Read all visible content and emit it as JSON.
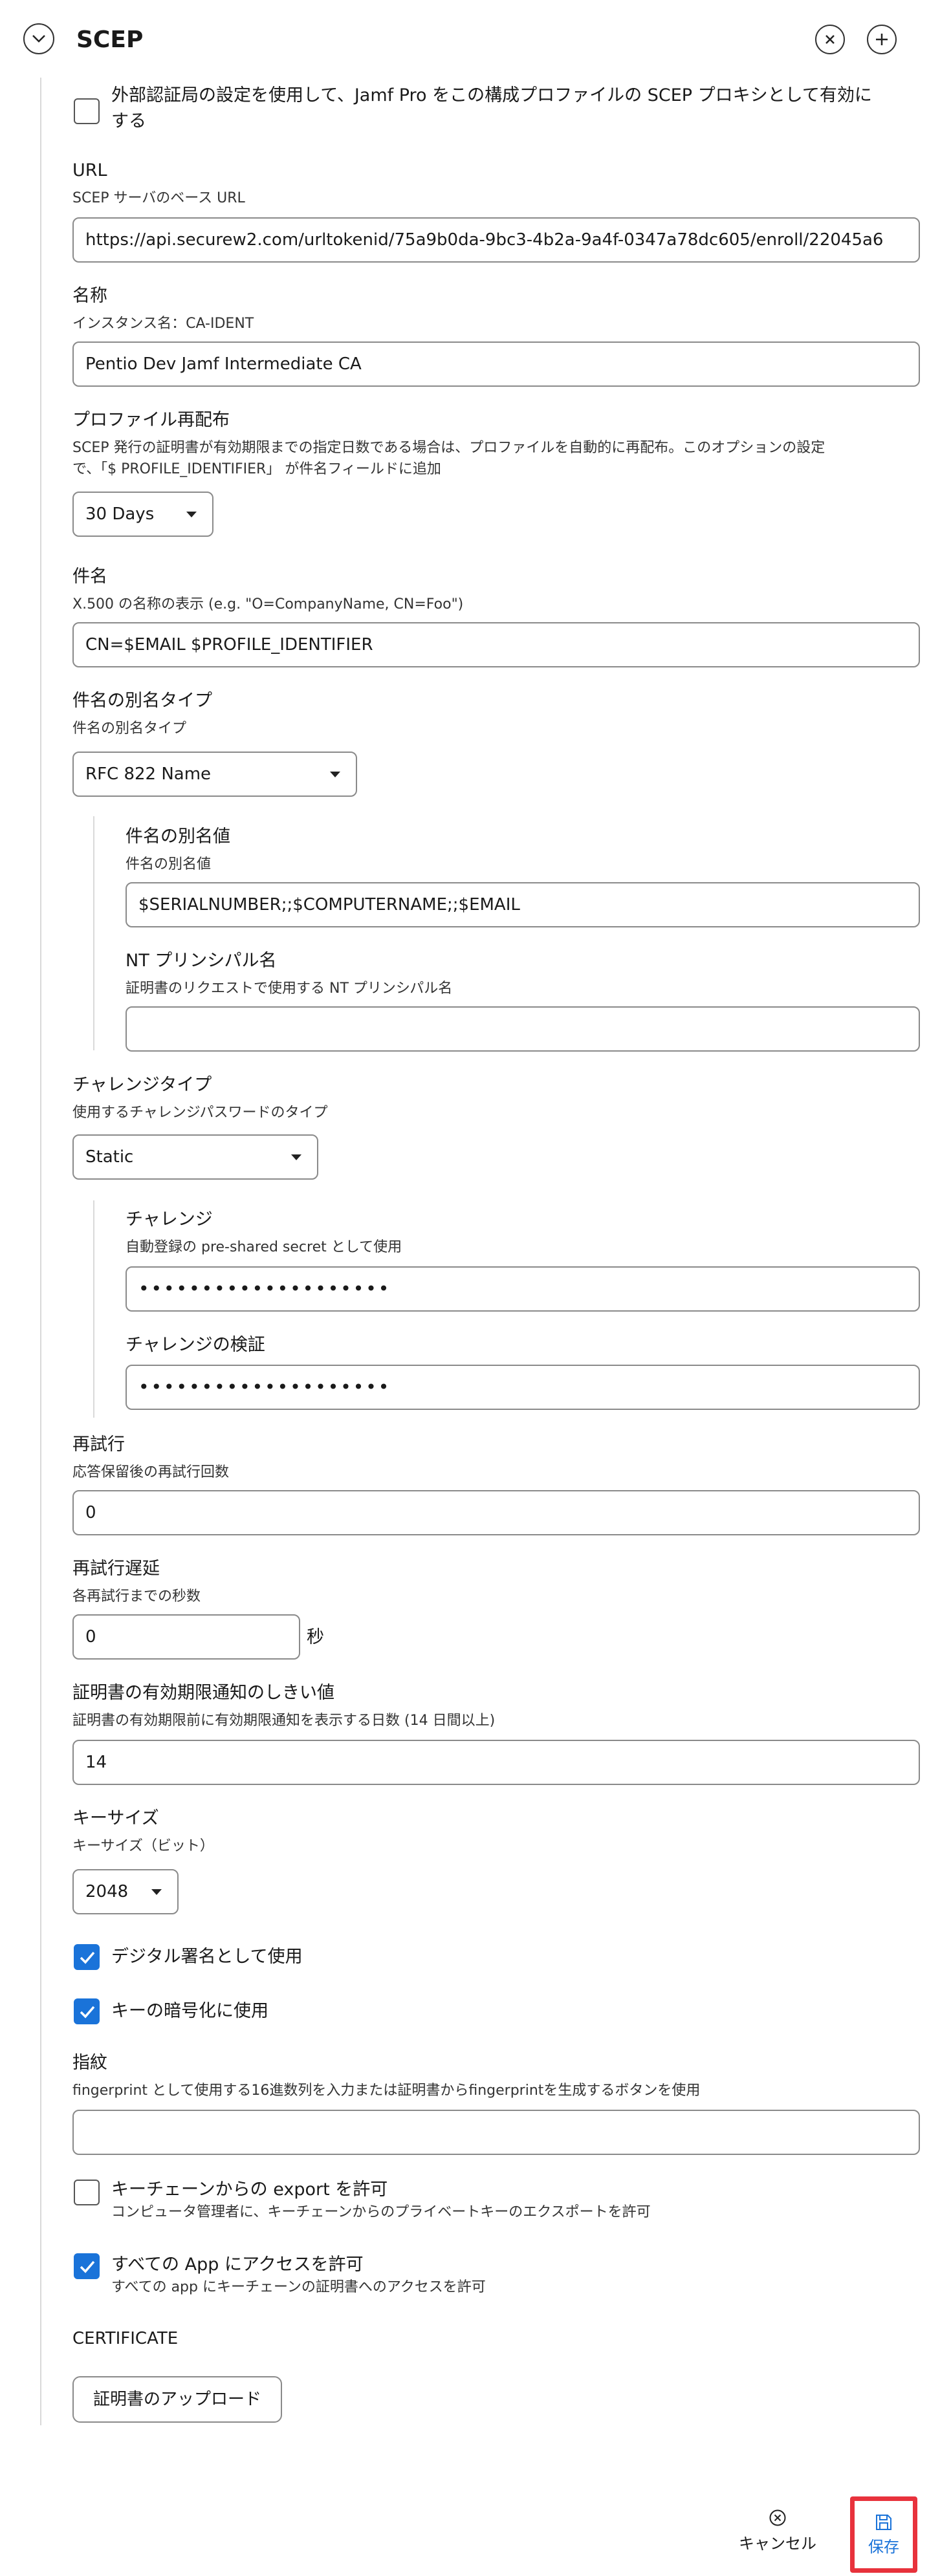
{
  "header": {
    "title": "SCEP"
  },
  "scep": {
    "proxy_checkbox_label_1": "外部認証局の設定を使用して、Jamf Pro をこの構成プロファイルの SCEP プロキシとして有効に",
    "proxy_checkbox_label_2": "する",
    "proxy_checked": false,
    "url_label": "URL",
    "url_desc": "SCEP サーバのベース URL",
    "url_value": "https://api.securew2.com/urltokenid/75a9b0da-9bc3-4b2a-9a4f-0347a78dc605/enroll/22045a6",
    "name_label": "名称",
    "name_desc": "インスタンス名：CA-IDENT",
    "name_value": "Pentio Dev Jamf Intermediate CA",
    "redist_label": "プロファイル再配布",
    "redist_desc_1": "SCEP 発行の証明書が有効期限までの指定日数である場合は、プロファイルを自動的に再配布。このオプションの設定",
    "redist_desc_2": "で、「$ PROFILE_IDENTIFIER」 が件名フィールドに追加",
    "redist_value": "30 Days",
    "subject_label": "件名",
    "subject_desc": "X.500 の名称の表示 (e.g. \"O=CompanyName, CN=Foo\")",
    "subject_value": "CN=$EMAIL $PROFILE_IDENTIFIER",
    "san_type_label": "件名の別名タイプ",
    "san_type_desc": "件名の別名タイプ",
    "san_type_value": "RFC 822 Name",
    "san_value_label": "件名の別名値",
    "san_value_desc": "件名の別名値",
    "san_value": "$SERIALNUMBER;;$COMPUTERNAME;;$EMAIL",
    "nt_label": "NT プリンシパル名",
    "nt_desc": "証明書のリクエストで使用する NT プリンシパル名",
    "nt_value": "",
    "challenge_type_label": "チャレンジタイプ",
    "challenge_type_desc": "使用するチャレンジパスワードのタイプ",
    "challenge_type_value": "Static",
    "challenge_label": "チャレンジ",
    "challenge_desc": "自動登録の pre-shared secret として使用",
    "challenge_value": "••••••••••••••••••••",
    "challenge_verify_label": "チャレンジの検証",
    "challenge_verify_value": "••••••••••••••••••••",
    "retries_label": "再試行",
    "retries_desc": "応答保留後の再試行回数",
    "retries_value": "0",
    "retry_delay_label": "再試行遅延",
    "retry_delay_desc": "各再試行までの秒数",
    "retry_delay_value": "0",
    "retry_delay_unit": "秒",
    "expiry_label": "証明書の有効期限通知のしきい値",
    "expiry_desc": "証明書の有効期限前に有効期限通知を表示する日数 (14 日間以上)",
    "expiry_value": "14",
    "keysize_label": "キーサイズ",
    "keysize_desc": "キーサイズ（ビット）",
    "keysize_value": "2048",
    "digital_sig_label": "デジタル署名として使用",
    "digital_sig_checked": true,
    "key_encipher_label": "キーの暗号化に使用",
    "key_encipher_checked": true,
    "fingerprint_label": "指紋",
    "fingerprint_desc": "fingerprint として使用する16進数列を入力または証明書からfingerprintを生成するボタンを使用",
    "fingerprint_value": "",
    "export_label": "キーチェーンからの export を許可",
    "export_desc": "コンピュータ管理者に、キーチェーンからのプライベートキーのエクスポートを許可",
    "export_checked": false,
    "all_apps_label": "すべての App にアクセスを許可",
    "all_apps_desc": "すべての app にキーチェーンの証明書へのアクセスを許可",
    "all_apps_checked": true,
    "certificate_label": "CERTIFICATE",
    "upload_button": "証明書のアップロード"
  },
  "footer": {
    "cancel_label": "キャンセル",
    "save_label": "保存"
  },
  "colors": {
    "accent": "#1a73d9",
    "highlight": "#e8323c"
  }
}
